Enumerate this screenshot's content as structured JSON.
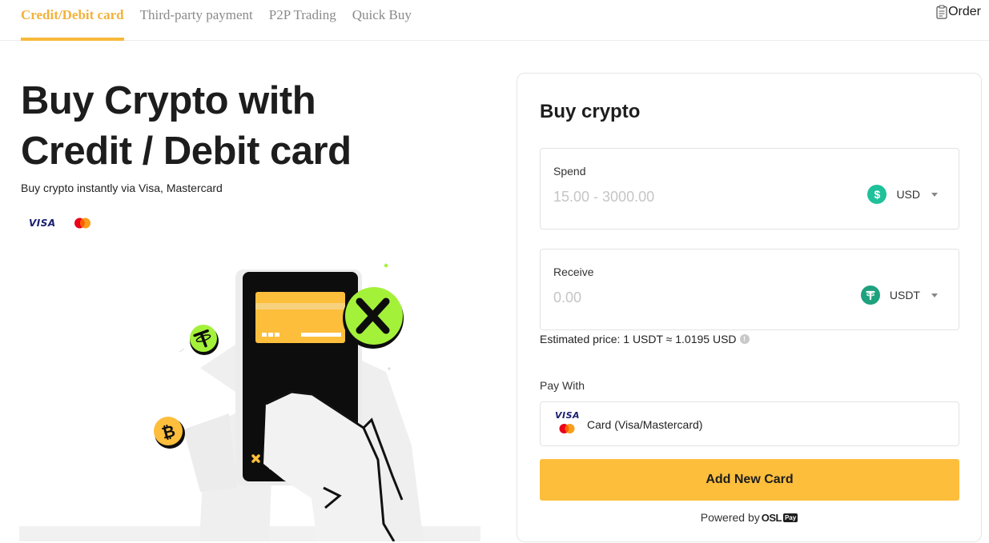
{
  "tabs": [
    {
      "label": "Credit/Debit card",
      "active": true
    },
    {
      "label": "Third-party payment",
      "active": false
    },
    {
      "label": "P2P Trading",
      "active": false
    },
    {
      "label": "Quick Buy",
      "active": false
    }
  ],
  "order_label": "Order",
  "hero": {
    "title_line1": "Buy Crypto with",
    "title_line2": "Credit / Debit card",
    "subtitle": "Buy crypto instantly via Visa, Mastercard",
    "visa_logo_text": "VISA",
    "card_brand_text": "XT"
  },
  "form": {
    "title": "Buy crypto",
    "spend": {
      "label": "Spend",
      "placeholder": "15.00 - 3000.00",
      "currency": "USD",
      "currency_icon": "dollar-coin-icon"
    },
    "receive": {
      "label": "Receive",
      "placeholder": "0.00",
      "currency": "USDT",
      "currency_icon": "tether-coin-icon"
    },
    "estimate": "Estimated price: 1 USDT ≈ 1.0195 USD",
    "pay_with_label": "Pay With",
    "pay_method": "Card (Visa/Mastercard)",
    "pay_visa_text": "VISA",
    "add_card_button": "Add New Card",
    "powered_by": "Powered by",
    "provider_name": "OSL",
    "provider_badge": "Pay"
  },
  "colors": {
    "accent": "#f7b93a",
    "button": "#fdbe3c",
    "lime": "#a4f13a",
    "usd_coin": "#1ec19a",
    "usdt_coin": "#1ea17e"
  }
}
